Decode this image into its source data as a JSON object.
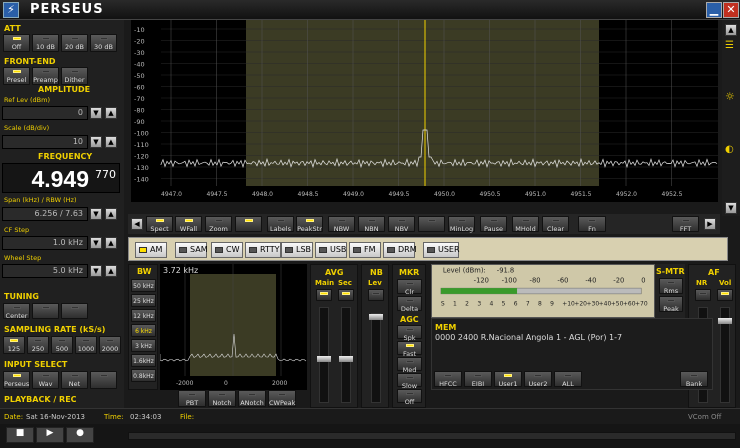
{
  "app": {
    "title": "PERSEUS",
    "icon": "perseus-icon"
  },
  "window": {
    "minimize_icon": "minimize-icon",
    "close_icon": "close-icon"
  },
  "att": {
    "title": "ATT",
    "buttons": [
      "Off",
      "10 dB",
      "20 dB",
      "30 dB"
    ],
    "active": 0
  },
  "frontend": {
    "title": "FRONT-END",
    "buttons": [
      "Presel",
      "Preamp",
      "Dither"
    ],
    "active": [
      0
    ]
  },
  "amplitude": {
    "title": "AMPLITUDE",
    "ref_label": "Ref Lev (dBm)",
    "ref_value": "0",
    "scale_label": "Scale (dB/div)",
    "scale_value": "10"
  },
  "frequency": {
    "title": "FREQUENCY",
    "main": "4.949",
    "sub": "770",
    "span_label": "Span (kHz) / RBW (Hz)",
    "span_value": "6.256 / 7.63",
    "cf_label": "CF Step",
    "cf_value": "1.0 kHz",
    "wheel_label": "Wheel Step",
    "wheel_value": "5.0 kHz"
  },
  "tuning": {
    "title": "TUNING",
    "buttons": [
      "Center",
      "",
      ""
    ]
  },
  "sampling": {
    "title": "SAMPLING RATE (kS/s)",
    "buttons": [
      "125",
      "250",
      "500",
      "1000",
      "2000"
    ],
    "active": 0
  },
  "input": {
    "title": "INPUT SELECT",
    "buttons": [
      "Perseus",
      "Wav",
      "Net",
      ""
    ],
    "active": 0
  },
  "playback": {
    "title": "PLAYBACK / REC"
  },
  "spectrum": {
    "y_ticks": [
      "-10",
      "-20",
      "-30",
      "-40",
      "-50",
      "-60",
      "-70",
      "-80",
      "-90",
      "-100",
      "-110",
      "-120",
      "-130",
      "-140"
    ],
    "x_ticks": [
      "4947.0",
      "4947.5",
      "4948.0",
      "4948.5",
      "4949.0",
      "4949.5",
      "4950.0",
      "4950.5",
      "4951.0",
      "4951.5",
      "4952.0",
      "4952.5"
    ]
  },
  "toolbar1": {
    "buttons": [
      "Spect",
      "WFall",
      "Zoom",
      "",
      "Labels",
      "PeakStr",
      "NBW",
      "NBN",
      "NBV",
      "",
      "MinLog",
      "Pause",
      "MHold",
      "Clear",
      "Fn",
      "FFT"
    ]
  },
  "modes": {
    "items": [
      "AM",
      "SAM",
      "CW",
      "RTTY",
      "LSB",
      "USB",
      "FM",
      "DRM",
      "USER"
    ],
    "active": 0
  },
  "bw": {
    "title": "BW",
    "items": [
      "50 kHz",
      "25 kHz",
      "12 kHz",
      "6 kHz",
      "3 kHz",
      "1.6kHz",
      "0.8kHz"
    ],
    "active": 3,
    "readout": "3.72 kHz",
    "x_ticks": [
      "-2000",
      "0",
      "2000"
    ]
  },
  "small_toolbar": {
    "buttons": [
      "PBT",
      "Notch",
      "ANotch",
      "CWPeak"
    ]
  },
  "avg": {
    "title": "AVG",
    "main": "Main",
    "sec": "Sec"
  },
  "nb": {
    "title": "NB",
    "lev": "Lev"
  },
  "mkr": {
    "title": "MKR",
    "buttons": [
      "Clr",
      "Delta"
    ]
  },
  "agc": {
    "title": "AGC",
    "buttons": [
      "Spk Rej",
      "Fast",
      "Med",
      "Slow",
      "Off"
    ],
    "active": 1
  },
  "meter": {
    "level_label": "Level (dBm):",
    "level_value": "-91.8",
    "top_scale": [
      "-120",
      "-100",
      "-80",
      "-60",
      "-40",
      "-20",
      "0"
    ],
    "bottom_scale": [
      "S",
      "1",
      "2",
      "3",
      "4",
      "5",
      "6",
      "7",
      "8",
      "9",
      "+10",
      "+20",
      "+30",
      "+40",
      "+50",
      "+60",
      "+70"
    ],
    "level_fraction": 0.38
  },
  "smtr": {
    "title": "S-MTR",
    "buttons": [
      "Rms",
      "Peak"
    ]
  },
  "af": {
    "title": "AF",
    "nr": "NR",
    "vol": "Vol"
  },
  "mem": {
    "title": "MEM",
    "entry": "0000  2400  R.Nacional Angola 1  - AGL (Por)  1-7",
    "buttons": [
      "HFCC",
      "EIBI",
      "User1",
      "User2",
      "ALL",
      "Bank"
    ]
  },
  "status": {
    "date_label": "Date:",
    "date": "Sat 16-Nov-2013",
    "time_label": "Time:",
    "time": "02:34:03",
    "file_label": "File:",
    "vcom": "VCom Off"
  },
  "colors": {
    "accent": "#f0d000",
    "spectrum_trace": "#e8e8e8",
    "passband": "#3b3b24"
  }
}
